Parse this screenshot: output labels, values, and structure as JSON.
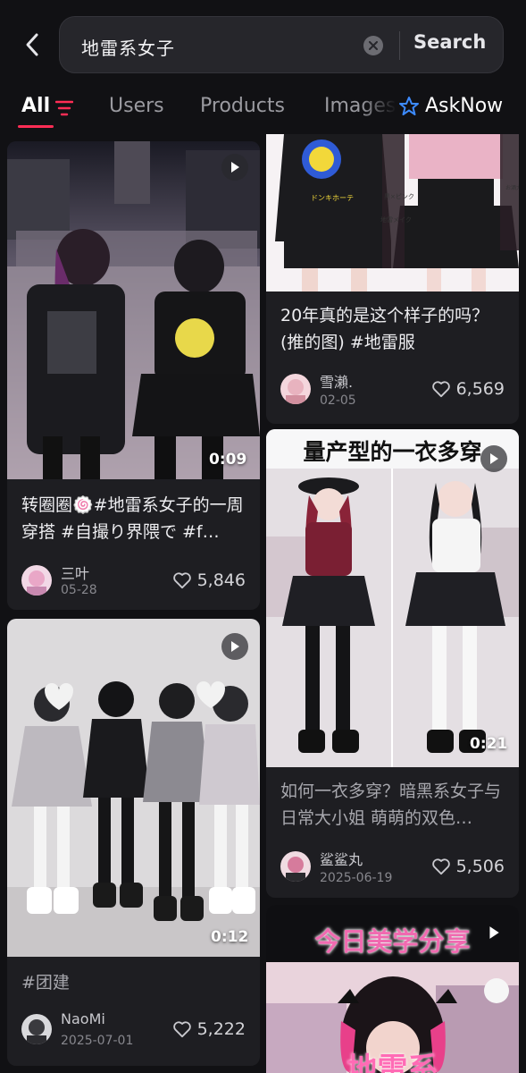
{
  "header": {
    "search_query": "地雷系女子",
    "search_button": "Search"
  },
  "tabs": [
    {
      "label": "All"
    },
    {
      "label": "Users"
    },
    {
      "label": "Products"
    },
    {
      "label": "Images"
    },
    {
      "label": "AskNow"
    }
  ],
  "cards": [
    {
      "duration": "0:09",
      "title": "转圈圈🍥#地雷系女子的一周穿搭 #自撮り界隈で #f…",
      "author": "三叶",
      "date": "05-28",
      "likes": "5,846"
    },
    {
      "duration": "0:12",
      "title": "#团建",
      "author": "NaoMi",
      "date": "2025-07-01",
      "likes": "5,222"
    },
    {
      "title": "20年真的是这个样子的吗？(推的图) #地雷服",
      "author": "雪瀨.",
      "date": "02-05",
      "likes": "6,569",
      "image_texts": [
        "ドンキホーテ",
        "黒×ピンク",
        "地雷メイク",
        "お酒大好き"
      ]
    },
    {
      "overlay": "量产型的一衣多穿",
      "duration": "0:21",
      "title": "如何一衣多穿？暗黑系女子与日常大小姐 萌萌的双色…",
      "author": "鲨鲨丸",
      "date": "2025-06-19",
      "likes": "5,506"
    },
    {
      "overlay": "今日美学分享",
      "partial_text": "地雷系"
    }
  ],
  "colors": {
    "background": "#111114",
    "card": "#1e1e22",
    "accent": "#ff2d55",
    "asknow_icon": "#3d8bff"
  }
}
